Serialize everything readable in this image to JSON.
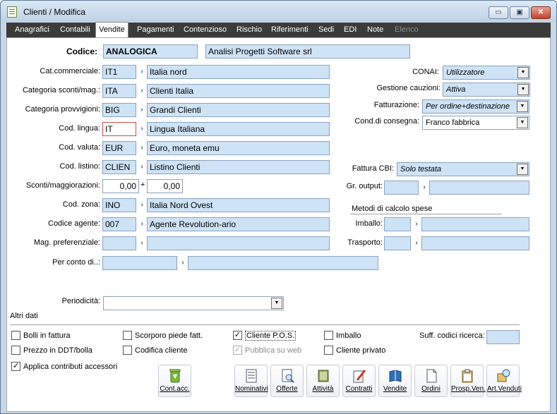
{
  "window": {
    "title": "Clienti / Modifica",
    "min_label": "▭",
    "restore_label": "▣",
    "close_label": "✕"
  },
  "tabs": [
    "Anagrafici",
    "Contabili",
    "Vendite",
    "Pagamenti",
    "Contenzioso",
    "Rischio",
    "Riferimenti",
    "Sedi",
    "EDI",
    "Note",
    "Elenco"
  ],
  "active_tab": "Vendite",
  "header": {
    "codice_label": "Codice:",
    "codice_value": "ANALOGICA",
    "ragione_sociale": "Analisi Progetti Software srl"
  },
  "left_fields": [
    {
      "label": "Cat.commerciale:",
      "code": "IT1",
      "desc": "Italia nord"
    },
    {
      "label": "Categoria sconti/mag.:",
      "code": "ITA",
      "desc": "Clienti Italia"
    },
    {
      "label": "Categoria provvigioni:",
      "code": "BIG",
      "desc": "Grandi Clienti"
    },
    {
      "label": "Cod. lingua:",
      "code": "IT",
      "desc": "Lingua Italiana"
    },
    {
      "label": "Cod. valuta:",
      "code": "EUR",
      "desc": "Euro, moneta emu"
    },
    {
      "label": "Cod. listino:",
      "code": "CLIEN",
      "desc": "Listino Clienti"
    }
  ],
  "sconti": {
    "label": "Sconti/maggiorazioni:",
    "value1": "0,00",
    "plus": "+",
    "value2": "0,00"
  },
  "left_fields2": [
    {
      "label": "Cod. zona:",
      "code": "INO",
      "desc": "Italia Nord Ovest"
    },
    {
      "label": "Codice agente:",
      "code": "007",
      "desc": "Agente Revolution-ario"
    },
    {
      "label": "Mag. preferenziale:",
      "code": "",
      "desc": ""
    }
  ],
  "per_conto": {
    "label": "Per conto di..:",
    "code": "",
    "desc": ""
  },
  "periodicita": {
    "label": "Periodicità:",
    "value": ""
  },
  "right": {
    "conai_label": "CONAI:",
    "conai_value": "Utilizzatore",
    "cauzioni_label": "Gestione cauzioni:",
    "cauzioni_value": "Attiva",
    "fatturazione_label": "Fatturazione:",
    "fatturazione_value": "Per ordine+destinazione",
    "consegna_label": "Cond.di consegna:",
    "consegna_value": "Franco fabbrica",
    "fattura_cbi_label": "Fattura CBI:",
    "fattura_cbi_value": "Solo testata",
    "gr_output_label": "Gr. output:",
    "metodi_label": "Metodi di calcolo spese",
    "imballo_label": "Imballo:",
    "trasporto_label": "Trasporto:"
  },
  "altri_dati": {
    "title": "Altri dati",
    "checkboxes": [
      {
        "label": "Bolli in fattura",
        "checked": false
      },
      {
        "label": "Prezzo in DDT/bolla",
        "checked": false
      },
      {
        "label": "Applica contributi accessori",
        "checked": true
      },
      {
        "label": "Scorporo piede fatt.",
        "checked": false
      },
      {
        "label": "Codifica cliente",
        "checked": false
      },
      {
        "label": "Cliente P.O.S.",
        "checked": true
      },
      {
        "label": "Pubblica su web",
        "checked": true
      },
      {
        "label": "Imballo",
        "checked": false
      },
      {
        "label": "Cliente privato",
        "checked": false
      }
    ],
    "suff_label": "Suff. codici ricerca:",
    "suff_value": ""
  },
  "buttons": [
    "Cont.acc.",
    "Nominativi",
    "Offerte",
    "Attività",
    "Contratti",
    "Vendite",
    "Ordini",
    "Prosp.Ven.",
    "Art.Venduti"
  ]
}
